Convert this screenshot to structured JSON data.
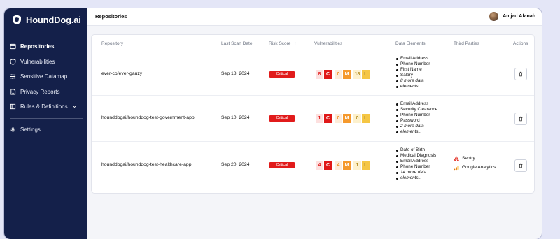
{
  "brand": {
    "name": "HoundDog.ai"
  },
  "sidebar": {
    "items": [
      {
        "label": "Repositories",
        "icon": "repositories-icon",
        "active": true
      },
      {
        "label": "Vulnerabilities",
        "icon": "shield-icon"
      },
      {
        "label": "Sensitive Datamap",
        "icon": "datamap-icon"
      },
      {
        "label": "Privacy Reports",
        "icon": "document-icon"
      },
      {
        "label": "Rules & Definitions",
        "icon": "book-icon",
        "chevron": "chevron-down-icon"
      }
    ],
    "settings": {
      "label": "Settings",
      "icon": "gear-icon"
    }
  },
  "header": {
    "title": "Repositories",
    "user_name": "Amjad Afanah"
  },
  "table": {
    "columns": {
      "repository": "Repository",
      "last_scan": "Last Scan Date",
      "risk": "Risk Score",
      "risk_sort": "↑",
      "vulnerabilities": "Vulnerabilities",
      "data_elements": "Data Elements",
      "third_parties": "Third Parties",
      "actions": "Actions"
    },
    "rows": [
      {
        "repository": "ever-co/ever-gauzy",
        "last_scan": "Sep 18, 2024",
        "risk": "Critical",
        "vuln": {
          "critical": "8",
          "critical_label": "C",
          "medium": "0",
          "medium_label": "M",
          "low": "18",
          "low_label": "L"
        },
        "data_elements": [
          "Email Address",
          "Phone Number",
          "First Name",
          "Salary",
          "8 more data",
          "elements..."
        ],
        "third_parties": []
      },
      {
        "repository": "hounddogai/hounddog-test-government-app",
        "last_scan": "Sep 10, 2024",
        "risk": "Critical",
        "vuln": {
          "critical": "1",
          "critical_label": "C",
          "medium": "0",
          "medium_label": "M",
          "low": "0",
          "low_label": "L"
        },
        "data_elements": [
          "Email Address",
          "Security Clearance",
          "Phone Number",
          "Password",
          "2 more data",
          "elements..."
        ],
        "third_parties": []
      },
      {
        "repository": "hounddogai/hounddog-test-healthcare-app",
        "last_scan": "Sep 20, 2024",
        "risk": "Critical",
        "vuln": {
          "critical": "4",
          "critical_label": "C",
          "medium": "4",
          "medium_label": "M",
          "low": "1",
          "low_label": "L"
        },
        "data_elements": [
          "Date of Birth",
          "Medical Diagnosis",
          "Email Address",
          "Phone Number",
          "14 more data",
          "elements..."
        ],
        "third_parties": [
          {
            "name": "Sentry",
            "icon": "sentry-icon"
          },
          {
            "name": "Google Analytics",
            "icon": "google-analytics-icon"
          }
        ]
      }
    ]
  },
  "colors": {
    "sidebar": "#14204a",
    "critical": "#e01818",
    "medium": "#f5992c",
    "low": "#f5c643"
  }
}
